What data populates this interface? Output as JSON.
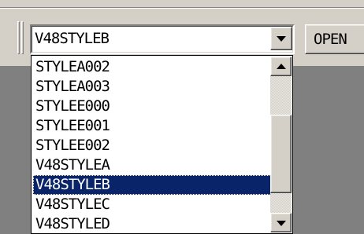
{
  "combo": {
    "value": "V48STYLEB",
    "dropdown_icon": "chevron-down-icon"
  },
  "open_button": {
    "label": "OPEN"
  },
  "dropdown": {
    "items": [
      {
        "label": "STYLEA002",
        "selected": false
      },
      {
        "label": "STYLEA003",
        "selected": false
      },
      {
        "label": "STYLEE000",
        "selected": false
      },
      {
        "label": "STYLEE001",
        "selected": false
      },
      {
        "label": "STYLEE002",
        "selected": false
      },
      {
        "label": "V48STYLEA",
        "selected": false
      },
      {
        "label": "V48STYLEB",
        "selected": true
      },
      {
        "label": "V48STYLEC",
        "selected": false
      },
      {
        "label": "V48STYLED",
        "selected": false
      }
    ],
    "selected_index": 6
  },
  "scrollbar": {
    "up_icon": "arrow-up-icon",
    "down_icon": "arrow-down-icon"
  },
  "colors": {
    "selection_bg": "#0a246a",
    "selection_fg": "#ffffff",
    "face": "#d4d0c8",
    "workspace": "#808080"
  }
}
